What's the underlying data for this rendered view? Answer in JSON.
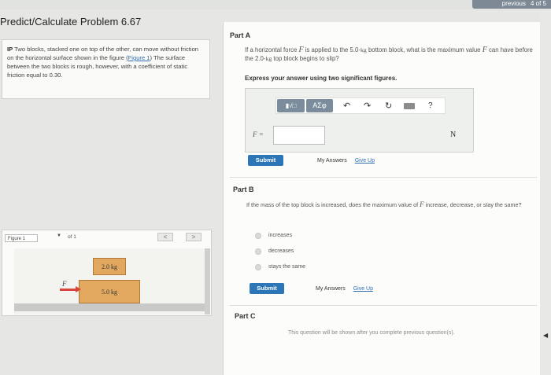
{
  "nav": {
    "previous": "previous",
    "position": "4 of 5"
  },
  "title": "Predict/Calculate Problem 6.67",
  "problem": {
    "tag": "IP",
    "text_before_link": "Two blocks, stacked one on top of the other, can move without friction on the horizontal surface shown in the figure (",
    "link": "Figure 1",
    "text_after_link": ") The surface between the two blocks is rough, however, with a coefficient of static friction equal to 0.30."
  },
  "figure": {
    "select_label": "Figure 1",
    "of_text": "of 1",
    "prev": "<",
    "next": ">",
    "top_block": "2.0 kg",
    "bottom_block": "5.0 kg",
    "force_label": "F"
  },
  "partA": {
    "heading": "Part A",
    "q1": "If a horizontal force ",
    "q_var": "F",
    "q2": " is applied to the 5.0-",
    "q_kg1": "kg",
    "q3": " bottom block, what is the maximum value ",
    "q_var2": "F",
    "q4": " can have before the 2.0-",
    "q_kg2": "kg",
    "q5": " top block begins to slip?",
    "instruction": "Express your answer using two significant figures.",
    "toolbar": {
      "templates": "▮√□",
      "greek": "ΑΣφ",
      "help": "?"
    },
    "var_label": "F =",
    "input_value": "",
    "unit": "N",
    "submit": "Submit",
    "my_answers": "My Answers",
    "give_up": "Give Up"
  },
  "partB": {
    "heading": "Part B",
    "q1": "If the mass of the top block is increased, does the maximum value of ",
    "q_var": "F",
    "q2": " increase, decrease, or stay the same?",
    "options": [
      "increases",
      "decreases",
      "stays the same"
    ],
    "submit": "Submit",
    "my_answers": "My Answers",
    "give_up": "Give Up"
  },
  "partC": {
    "heading": "Part C",
    "note": "This question will be shown after you complete previous question(s)."
  }
}
